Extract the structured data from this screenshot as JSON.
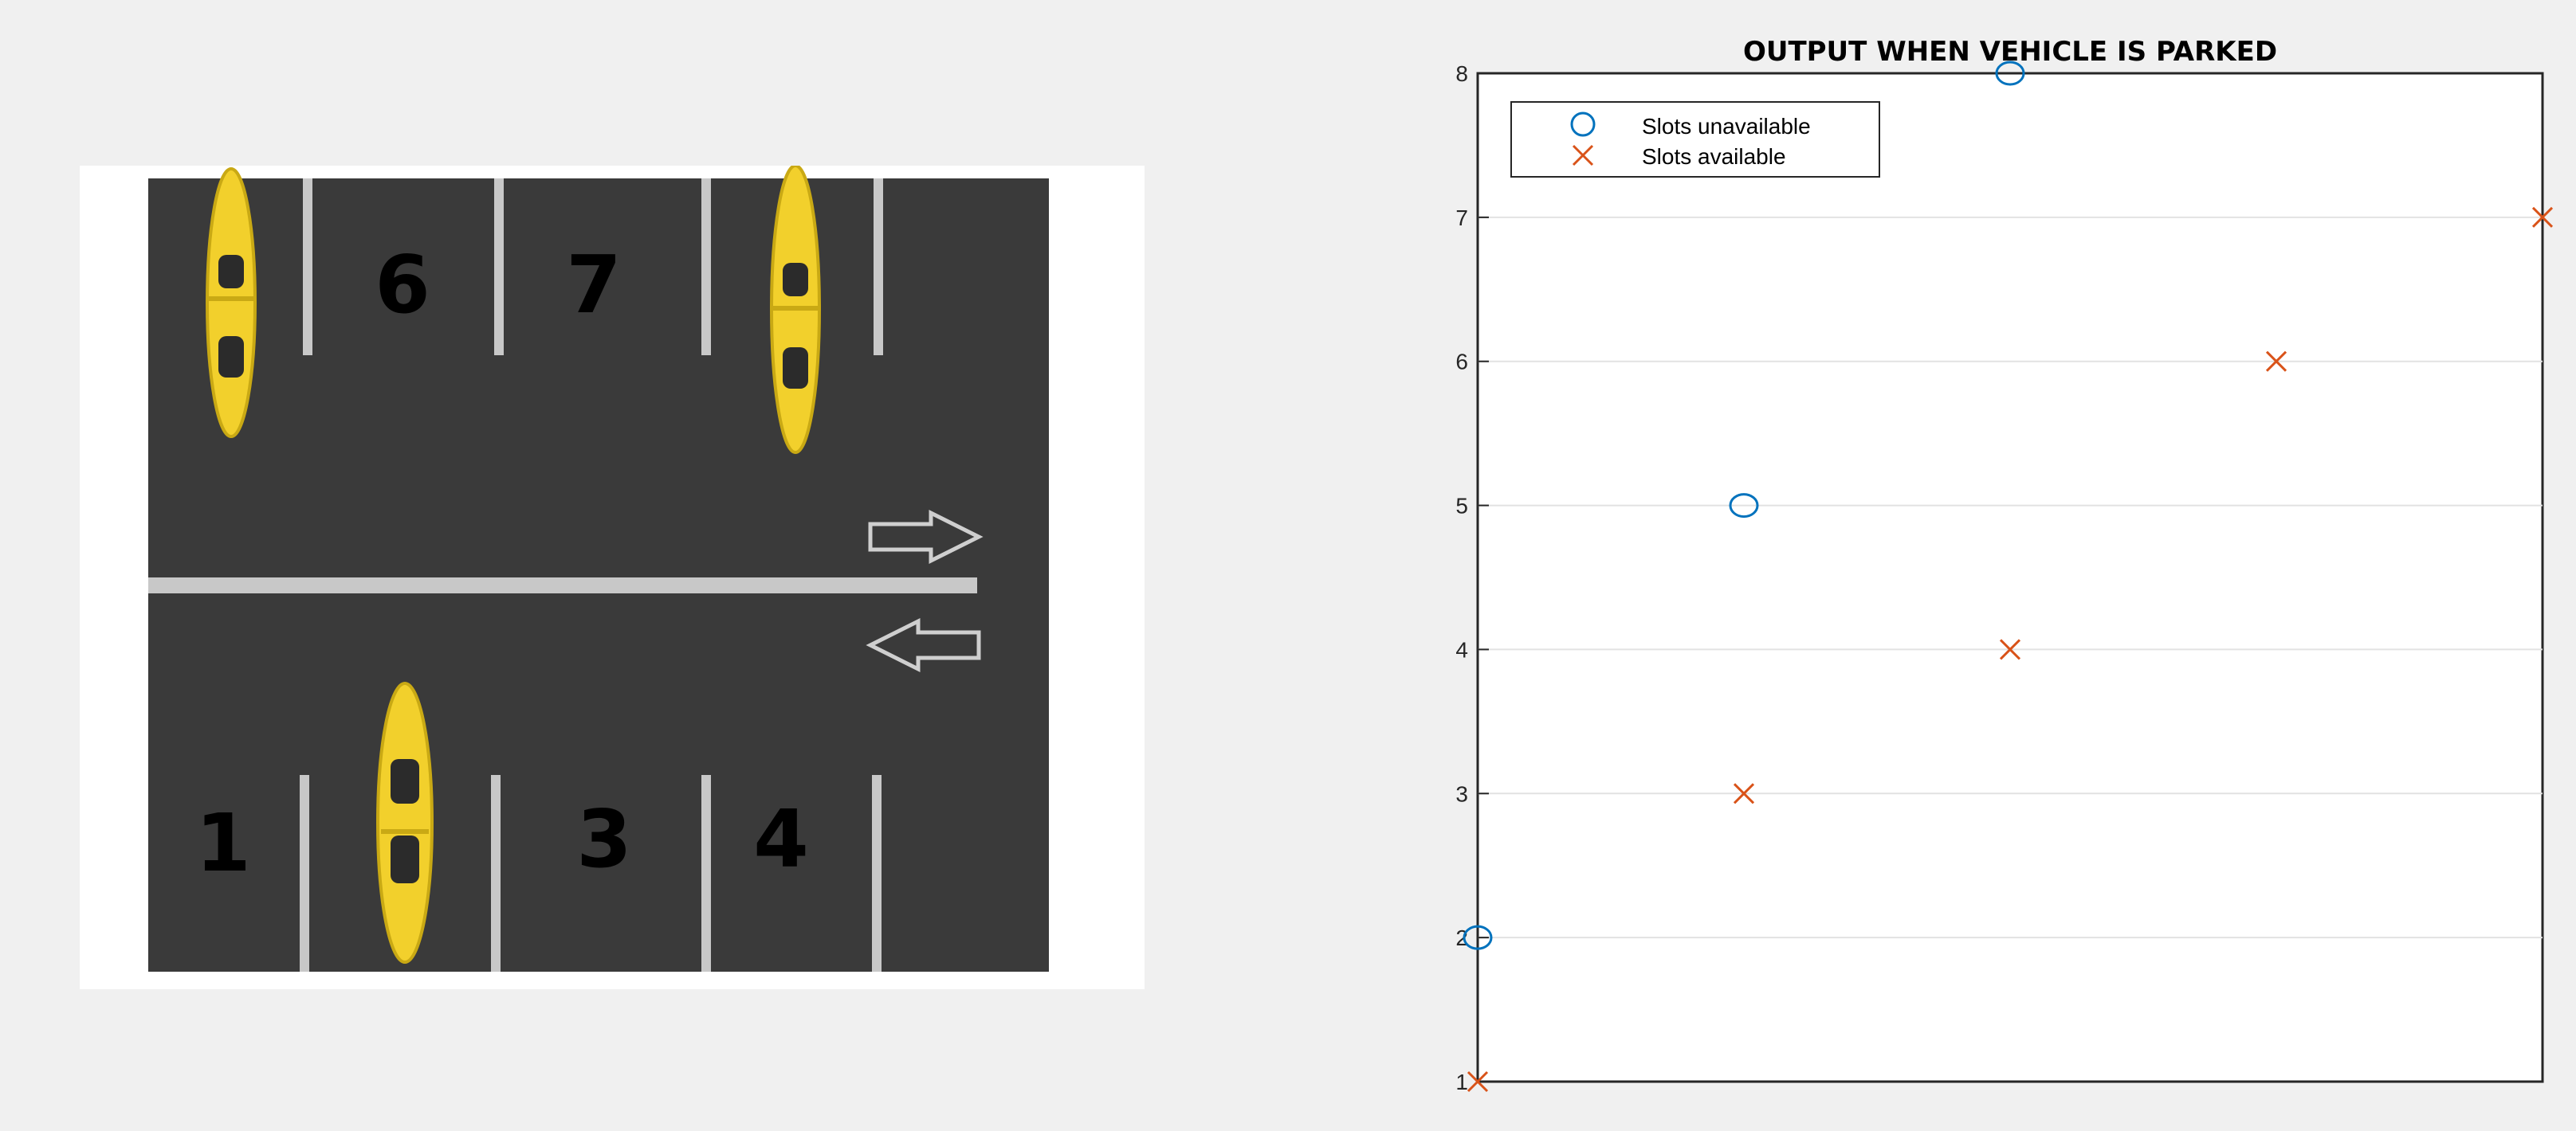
{
  "parking_lot": {
    "slots_top": [
      {
        "number": "",
        "occupied": true
      },
      {
        "number": "6",
        "occupied": false
      },
      {
        "number": "7",
        "occupied": false
      },
      {
        "number": "",
        "occupied": true
      },
      {
        "number": "",
        "occupied": false
      }
    ],
    "slots_bottom": [
      {
        "number": "1",
        "occupied": false
      },
      {
        "number": "",
        "occupied": true
      },
      {
        "number": "3",
        "occupied": false
      },
      {
        "number": "4",
        "occupied": false
      },
      {
        "number": "",
        "occupied": false
      }
    ],
    "arrows": [
      "arrow-right-icon",
      "arrow-left-icon"
    ],
    "colors": {
      "asphalt": "#3a3a3a",
      "lines": "#c8c8c8",
      "car_body": "#f2d02c",
      "car_glass": "#2b2b2b"
    }
  },
  "chart_data": {
    "type": "scatter",
    "title": "OUTPUT WHEN VEHICLE IS PARKED",
    "xlabel": "",
    "ylabel": "",
    "xlim": [
      1,
      5
    ],
    "ylim": [
      1,
      8
    ],
    "yticks": [
      1,
      2,
      3,
      4,
      5,
      6,
      7,
      8
    ],
    "grid": "horizontal",
    "legend_position": "top-left",
    "series": [
      {
        "name": "Slots unavailable",
        "marker": "circle",
        "color": "#0072bd",
        "x": [
          1,
          2,
          3
        ],
        "y": [
          2,
          5,
          8
        ]
      },
      {
        "name": "Slots available",
        "marker": "cross",
        "color": "#d95319",
        "x": [
          1,
          2,
          3,
          4,
          5
        ],
        "y": [
          1,
          3,
          4,
          6,
          7
        ]
      }
    ]
  }
}
